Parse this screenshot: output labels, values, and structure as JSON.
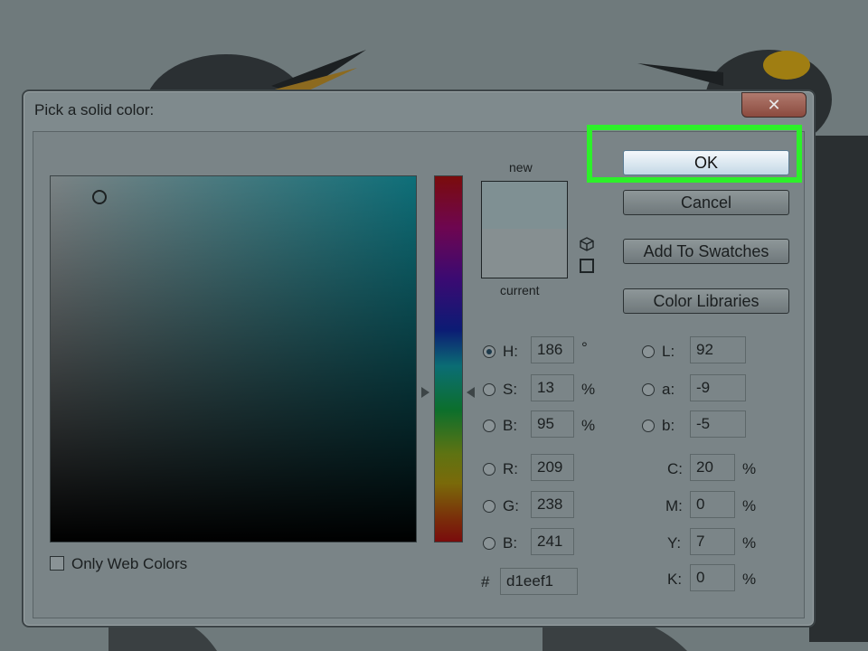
{
  "dialog": {
    "title": "Pick a solid color:",
    "close_glyph": "✕"
  },
  "buttons": {
    "ok": "OK",
    "cancel": "Cancel",
    "add_to_swatches": "Add To Swatches",
    "color_libraries": "Color Libraries"
  },
  "preview": {
    "new_label": "new",
    "current_label": "current",
    "new_color": "#d1eef1",
    "current_color": "#d1eef1"
  },
  "hsb": [
    {
      "key": "h",
      "label": "H:",
      "value": "186",
      "unit": "°",
      "selected": true
    },
    {
      "key": "s",
      "label": "S:",
      "value": "13",
      "unit": "%",
      "selected": false
    },
    {
      "key": "b",
      "label": "B:",
      "value": "95",
      "unit": "%",
      "selected": false
    }
  ],
  "rgb": [
    {
      "key": "r",
      "label": "R:",
      "value": "209"
    },
    {
      "key": "g",
      "label": "G:",
      "value": "238"
    },
    {
      "key": "b",
      "label": "B:",
      "value": "241"
    }
  ],
  "lab": [
    {
      "key": "l",
      "label": "L:",
      "value": "92"
    },
    {
      "key": "a",
      "label": "a:",
      "value": "-9"
    },
    {
      "key": "b",
      "label": "b:",
      "value": "-5"
    }
  ],
  "cmyk": [
    {
      "key": "c",
      "label": "C:",
      "value": "20",
      "unit": "%"
    },
    {
      "key": "m",
      "label": "M:",
      "value": "0",
      "unit": "%"
    },
    {
      "key": "y",
      "label": "Y:",
      "value": "7",
      "unit": "%"
    },
    {
      "key": "k",
      "label": "K:",
      "value": "0",
      "unit": "%"
    }
  ],
  "hex": {
    "label": "#",
    "value": "d1eef1"
  },
  "only_web_colors": {
    "label": "Only Web Colors",
    "checked": false
  },
  "colors": {
    "highlight": "#2df02a"
  }
}
